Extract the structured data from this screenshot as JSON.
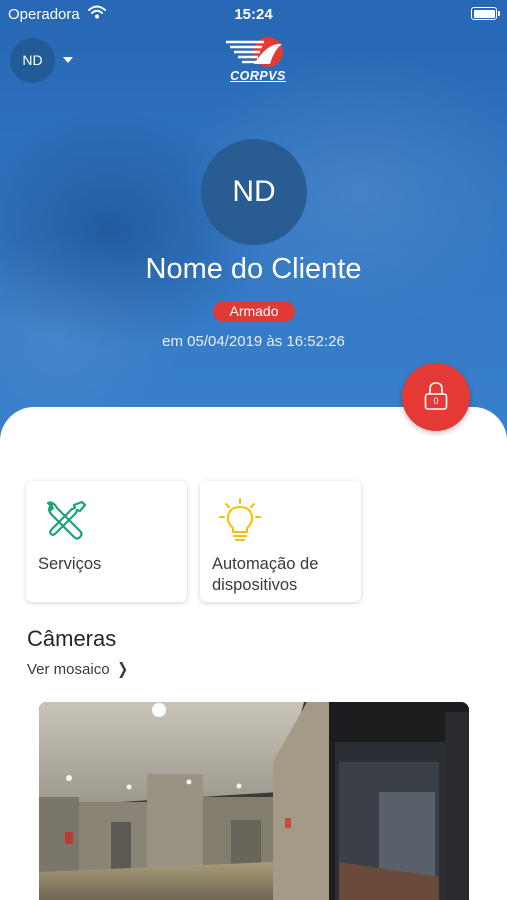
{
  "status_bar": {
    "carrier": "Operadora",
    "time": "15:24",
    "icons": [
      "wifi-icon",
      "battery-icon"
    ]
  },
  "header": {
    "account_initials": "ND",
    "logo_text": "CORPVS"
  },
  "profile": {
    "initials": "ND",
    "name": "Nome do Cliente",
    "status": "Armado",
    "status_time": "em 05/04/2019 às 16:52:26"
  },
  "lock_button": {
    "icon": "lock-icon",
    "count": "0"
  },
  "cards": [
    {
      "icon": "tools-icon",
      "label": "Serviços"
    },
    {
      "icon": "lightbulb-icon",
      "label": "Automação de dispositivos"
    }
  ],
  "cameras": {
    "title": "Câmeras",
    "link_label": "Ver mosaico",
    "link_icon": "chevron-right-icon"
  },
  "colors": {
    "header_blue": "#2f74c1",
    "alert_red": "#e53935",
    "badge_red": "#e03a36",
    "service_green": "#1aa37a",
    "automation_yellow": "#f2c200"
  }
}
